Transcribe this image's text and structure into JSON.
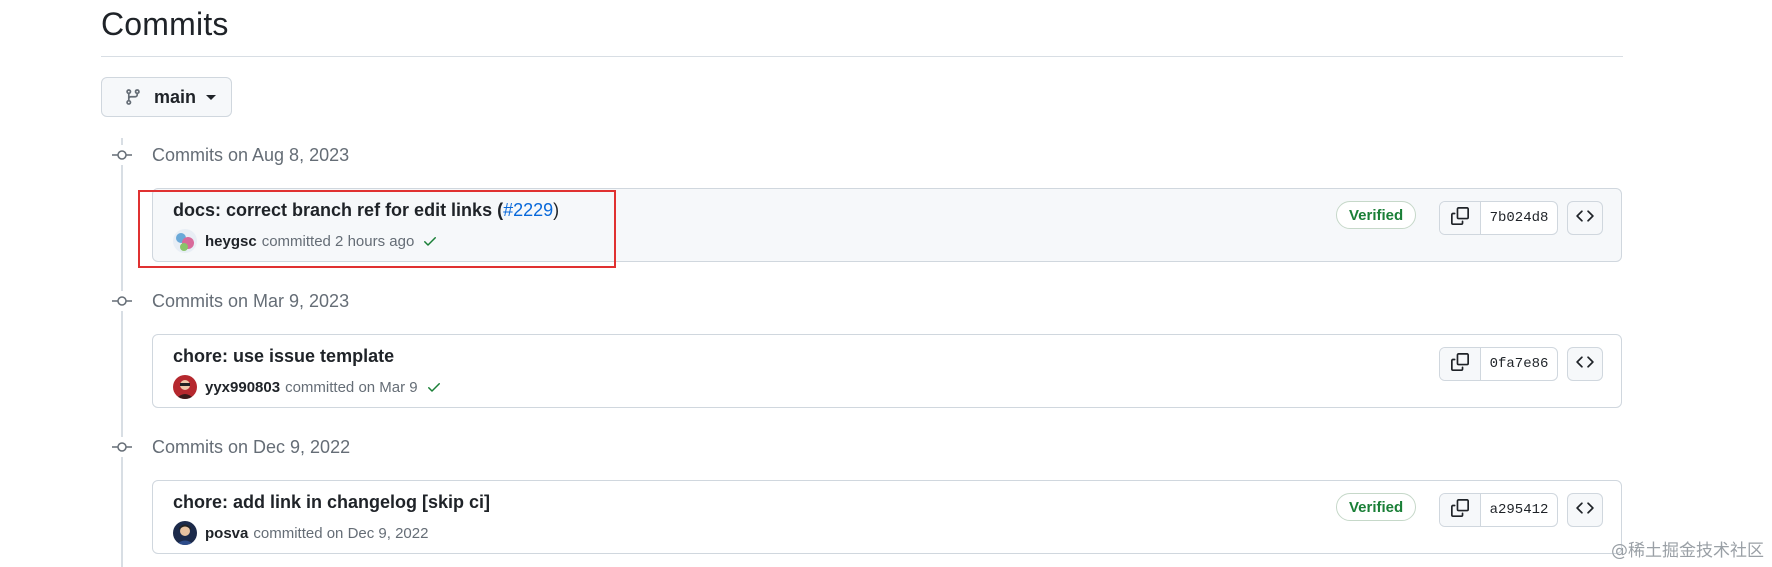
{
  "page": {
    "title": "Commits"
  },
  "branch": {
    "name": "main"
  },
  "groups": [
    {
      "heading": "Commits on Aug 8, 2023",
      "commit": {
        "title": "docs: correct branch ref for edit links (",
        "pr": "#2229",
        "title_suffix": ")",
        "author": "heygsc",
        "action": "committed 2 hours ago",
        "verified": "Verified",
        "sha": "7b024d8"
      }
    },
    {
      "heading": "Commits on Mar 9, 2023",
      "commit": {
        "title": "chore: use issue template",
        "author": "yyx990803",
        "action": "committed on Mar 9",
        "sha": "0fa7e86"
      }
    },
    {
      "heading": "Commits on Dec 9, 2022",
      "commit": {
        "title": "chore: add link in changelog [skip ci]",
        "author": "posva",
        "action": "committed on Dec 9, 2022",
        "verified": "Verified",
        "sha": "a295412"
      }
    }
  ],
  "watermark": "@稀土掘金技术社区",
  "colors": {
    "link": "#0969da",
    "success": "#1a7f37",
    "annotation": "#e03131",
    "muted_text": "#656d76"
  },
  "icons": [
    "git-branch-icon",
    "caret-down-icon",
    "git-commit-icon",
    "check-icon",
    "copy-icon",
    "code-icon"
  ]
}
